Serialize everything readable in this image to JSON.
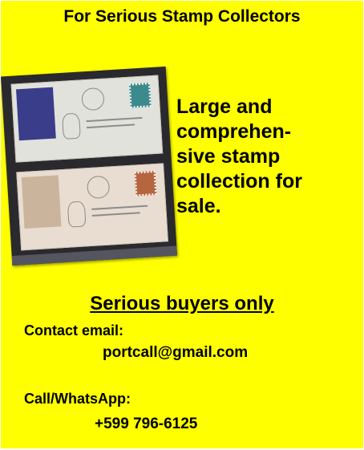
{
  "flyer": {
    "heading": "For Serious Stamp Collectors",
    "description_lines": [
      "Large and",
      "comprehen-",
      "sive stamp",
      "collection for",
      "sale."
    ],
    "buyers_note": "Serious buyers only",
    "email_label": "Contact email:",
    "email": "portcall@gmail.com",
    "phone_label": "Call/WhatsApp:",
    "phone": "+599 796-6125",
    "colors": {
      "background": "#ffff00",
      "text": "#000000"
    }
  },
  "photo": {
    "icon": "stamp-covers-photo"
  }
}
